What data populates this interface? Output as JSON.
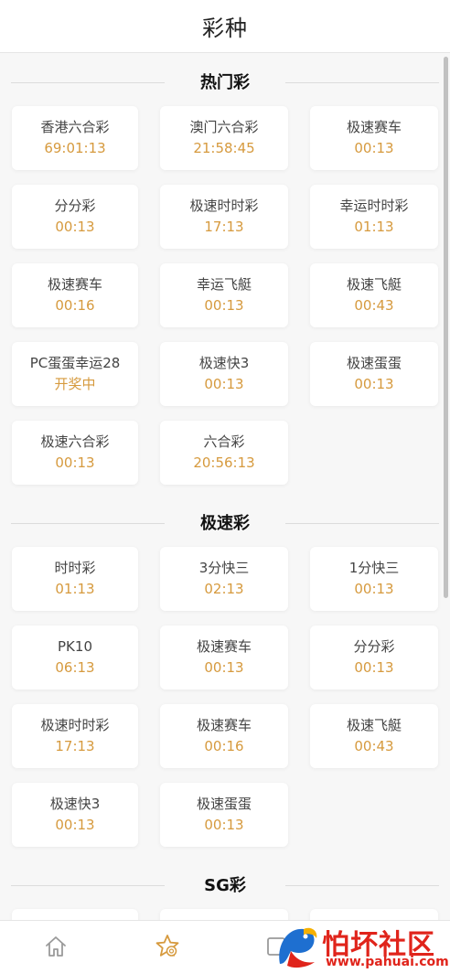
{
  "header": {
    "title": "彩种"
  },
  "sections": [
    {
      "title": "热门彩",
      "items": [
        {
          "name": "香港六合彩",
          "time": "69:01:13"
        },
        {
          "name": "澳门六合彩",
          "time": "21:58:45"
        },
        {
          "name": "极速赛车",
          "time": "00:13"
        },
        {
          "name": "分分彩",
          "time": "00:13"
        },
        {
          "name": "极速时时彩",
          "time": "17:13"
        },
        {
          "name": "幸运时时彩",
          "time": "01:13"
        },
        {
          "name": "极速赛车",
          "time": "00:16"
        },
        {
          "name": "幸运飞艇",
          "time": "00:13"
        },
        {
          "name": "极速飞艇",
          "time": "00:43"
        },
        {
          "name": "PC蛋蛋幸运28",
          "time": "开奖中"
        },
        {
          "name": "极速快3",
          "time": "00:13"
        },
        {
          "name": "极速蛋蛋",
          "time": "00:13"
        },
        {
          "name": "极速六合彩",
          "time": "00:13"
        },
        {
          "name": "六合彩",
          "time": "20:56:13"
        }
      ]
    },
    {
      "title": "极速彩",
      "items": [
        {
          "name": "时时彩",
          "time": "01:13"
        },
        {
          "name": "3分快三",
          "time": "02:13"
        },
        {
          "name": "1分快三",
          "time": "00:13"
        },
        {
          "name": "PK10",
          "time": "06:13"
        },
        {
          "name": "极速赛车",
          "time": "00:13"
        },
        {
          "name": "分分彩",
          "time": "00:13"
        },
        {
          "name": "极速时时彩",
          "time": "17:13"
        },
        {
          "name": "极速赛车",
          "time": "00:16"
        },
        {
          "name": "极速飞艇",
          "time": "00:43"
        },
        {
          "name": "极速快3",
          "time": "00:13"
        },
        {
          "name": "极速蛋蛋",
          "time": "00:13"
        }
      ]
    },
    {
      "title": "SG彩",
      "items": [
        {
          "name": "",
          "time": ""
        },
        {
          "name": "",
          "time": ""
        },
        {
          "name": "",
          "time": ""
        }
      ]
    }
  ],
  "tabbar": {
    "icons": [
      "home-icon",
      "lottery-star-icon"
    ],
    "active_color": "#d69a3e",
    "inactive_color": "#9a9a9a"
  },
  "watermark": {
    "text": "怕坏社区",
    "url": "www.pahuai.com"
  },
  "colors": {
    "accent": "#d69a3e",
    "background": "#f7f7f7"
  }
}
